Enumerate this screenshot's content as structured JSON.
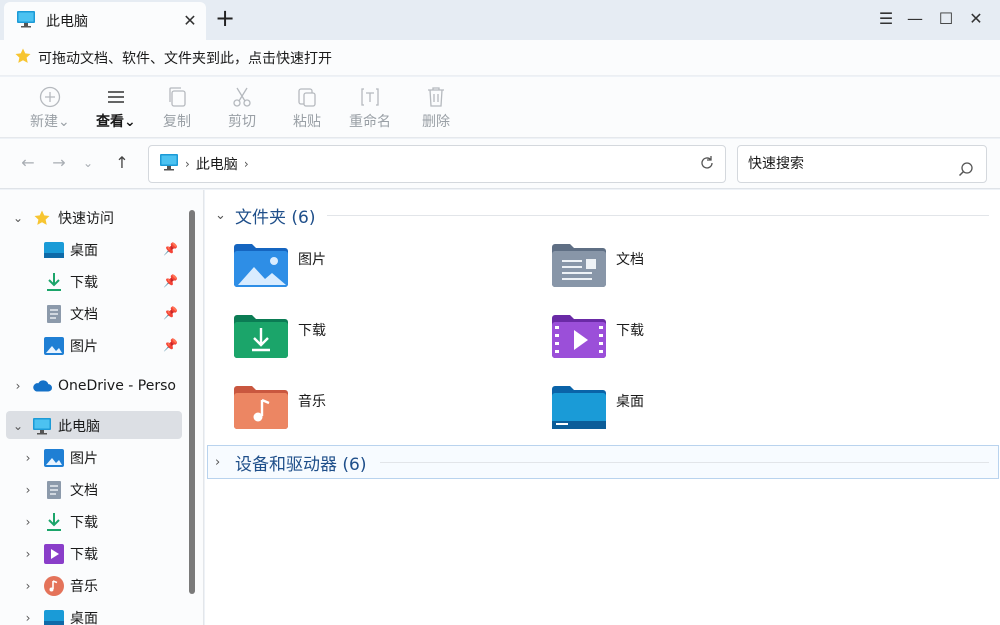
{
  "titlebar": {
    "tab_title": "此电脑",
    "close_tab_glyph": "✕",
    "new_tab_glyph": "+",
    "menu_glyph": "☰",
    "minimize_glyph": "—",
    "maximize_glyph": "☐",
    "close_glyph": "✕"
  },
  "hint": {
    "text": "可拖动文档、软件、文件夹到此，点击快速打开"
  },
  "toolbar": {
    "new_label": "新建",
    "view_label": "查看",
    "copy_label": "复制",
    "cut_label": "剪切",
    "paste_label": "粘贴",
    "rename_label": "重命名",
    "delete_label": "删除"
  },
  "address": {
    "path": "此电脑",
    "search_placeholder": "快速搜索"
  },
  "sidebar": {
    "quick_access": {
      "label": "快速访问",
      "items": [
        {
          "label": "桌面",
          "icon": "desktop-icon"
        },
        {
          "label": "下载",
          "icon": "download-icon"
        },
        {
          "label": "文档",
          "icon": "document-icon"
        },
        {
          "label": "图片",
          "icon": "picture-icon"
        }
      ]
    },
    "onedrive": {
      "label": "OneDrive - Perso"
    },
    "this_pc": {
      "label": "此电脑",
      "items": [
        {
          "label": "图片",
          "icon": "picture-icon"
        },
        {
          "label": "文档",
          "icon": "document-icon"
        },
        {
          "label": "下载",
          "icon": "download-icon"
        },
        {
          "label": "下载",
          "icon": "video-icon"
        },
        {
          "label": "音乐",
          "icon": "music-icon"
        },
        {
          "label": "桌面",
          "icon": "desktop-icon"
        }
      ]
    }
  },
  "main": {
    "folders_header": "文件夹 (6)",
    "devices_header": "设备和驱动器 (6)",
    "folders": [
      {
        "name": "图片",
        "icon": "pictures-folder-icon"
      },
      {
        "name": "文档",
        "icon": "documents-folder-icon"
      },
      {
        "name": "下载",
        "icon": "downloads-folder-icon"
      },
      {
        "name": "下载",
        "icon": "videos-folder-icon"
      },
      {
        "name": "音乐",
        "icon": "music-folder-icon"
      },
      {
        "name": "桌面",
        "icon": "desktop-folder-icon"
      }
    ]
  },
  "colors": {
    "accent": "#1f4f8a",
    "selection": "#dcdfe4",
    "titlebar_bg": "#e6ecf3"
  }
}
